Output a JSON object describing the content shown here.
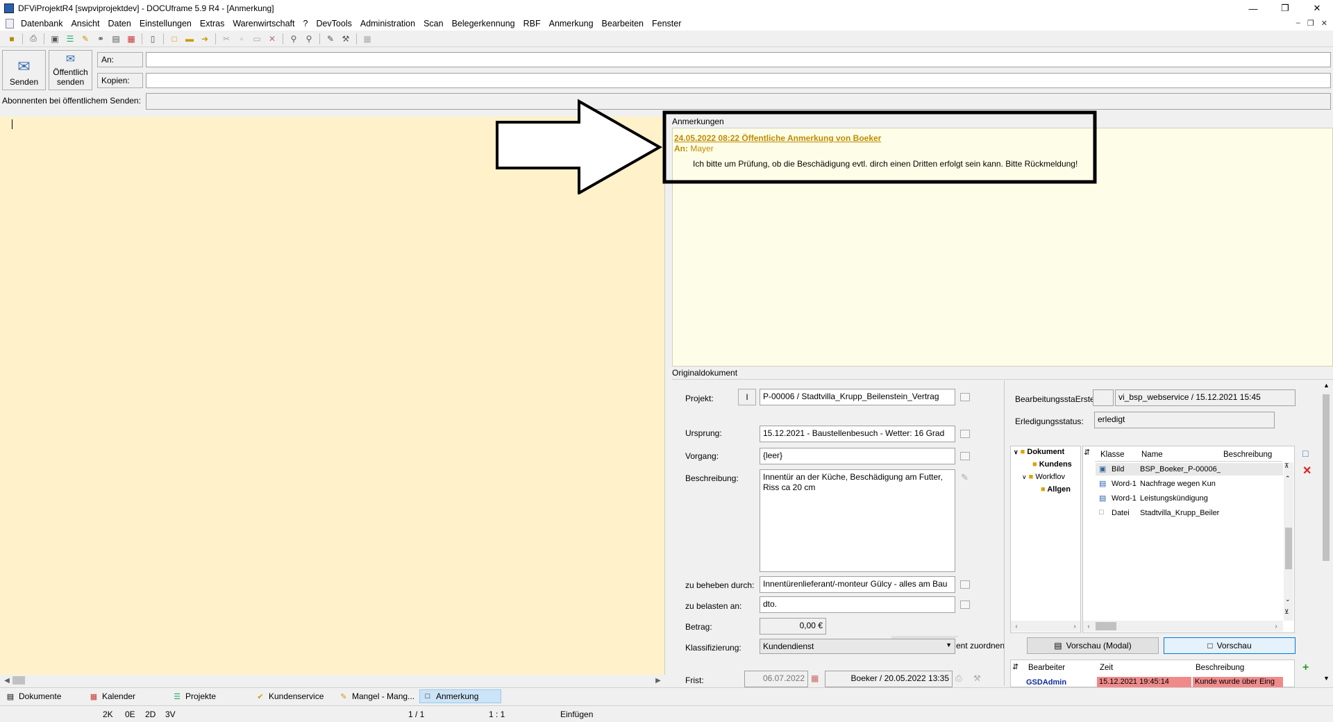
{
  "window": {
    "title": "DFViProjektR4 [swpviprojektdev] - DOCUframe 5.9 R4 - [Anmerkung]"
  },
  "menu": [
    "Datenbank",
    "Ansicht",
    "Daten",
    "Einstellungen",
    "Extras",
    "Warenwirtschaft",
    "?",
    "DevTools",
    "Administration",
    "Scan",
    "Belegerkennung",
    "RBF",
    "Anmerkung",
    "Bearbeiten",
    "Fenster"
  ],
  "send": {
    "send_label": "Senden",
    "public_label_1": "Öffentlich",
    "public_label_2": "senden",
    "to_label": "An:",
    "to_value": "",
    "cc_label": "Kopien:",
    "cc_value": "",
    "subscribers_label": "Abonnenten bei öffentlichem Senden:",
    "subscribers_value": ""
  },
  "notes": {
    "section_label": "Anmerkungen",
    "entry": {
      "header": "24.05.2022 08:22 Öffentliche Anmerkung von Boeker",
      "to_prefix": "An:",
      "to_name": "Mayer",
      "text": "Ich bitte um Prüfung, ob die Beschädigung evtl. dirch einen Dritten erfolgt sein kann. Bitte Rückmeldung!"
    }
  },
  "original": {
    "section_label": "Originaldokument",
    "projekt_label": "Projekt:",
    "projekt_btn": "I",
    "projekt_value": "P-00006 / Stadtvilla_Krupp_Beilenstein_Vertrag",
    "ursprung_label": "Ursprung:",
    "ursprung_value": "15.12.2021 - Baustellenbesuch - Wetter: 16 Grad",
    "vorgang_label": "Vorgang:",
    "vorgang_value": "{leer}",
    "beschreibung_label": "Beschreibung:",
    "beschreibung_value": "Innentür an der Küche, Beschädigung am Futter, Riss ca 20 cm",
    "beheben_label": "zu beheben durch:",
    "beheben_value": "Innentürenlieferant/-monteur Gülcy - alles am Bau",
    "belasten_label": "zu belasten an:",
    "belasten_value": "dto.",
    "betrag_label": "Betrag:",
    "betrag_value": "0,00 €",
    "klass_label": "Klassifizierung:",
    "klass_value": "Kundendienst",
    "frist_label": "Frist:",
    "frist_value": "06.07.2022",
    "frist_user": "Boeker / 20.05.2022 13:35",
    "status_label": "BearbeitungsstaErstellt:",
    "status_value": "vi_bsp_webservice / 15.12.2021 15:45",
    "erledigung_label": "Erledigungsstatus:",
    "erledigung_value": "erledigt",
    "zuordnen_label": "ent zuordnen"
  },
  "tree": {
    "root": "Dokument",
    "child1": "Kundens",
    "child2": "Workflov",
    "child3": "Allgen"
  },
  "docs": {
    "columns": [
      "Klasse",
      "Name",
      "Beschreibung"
    ],
    "rows": [
      {
        "klasse": "Bild",
        "name": "BSP_Boeker_P-00006_",
        "beschr": ""
      },
      {
        "klasse": "Word-1",
        "name": "Nachfrage wegen Kun",
        "beschr": ""
      },
      {
        "klasse": "Word-1",
        "name": "Leistungskündigung",
        "beschr": ""
      },
      {
        "klasse": "Datei",
        "name": "Stadtvilla_Krupp_Beiler",
        "beschr": ""
      }
    ]
  },
  "preview": {
    "modal_label": "Vorschau (Modal)",
    "label": "Vorschau"
  },
  "history": {
    "columns": [
      "Bearbeiter",
      "Zeit",
      "Beschreibung"
    ],
    "row": {
      "user": "GSDAdmin",
      "time": "15.12.2021 19:45:14",
      "desc": "Kunde wurde über Eing"
    }
  },
  "tabs": [
    "Dokumente",
    "Kalender",
    "Projekte",
    "Kundenservice",
    "Mangel - Mang...",
    "Anmerkung"
  ],
  "status": {
    "s1": "2K",
    "s2": "0E",
    "s3": "2D",
    "s4": "3V",
    "page": "1 / 1",
    "zoom": "1 : 1",
    "mode": "Einfügen"
  },
  "colors": {
    "editor_bg": "#fff1c9",
    "note_accent": "#c08a00",
    "history_highlight": "#f08a8a"
  }
}
